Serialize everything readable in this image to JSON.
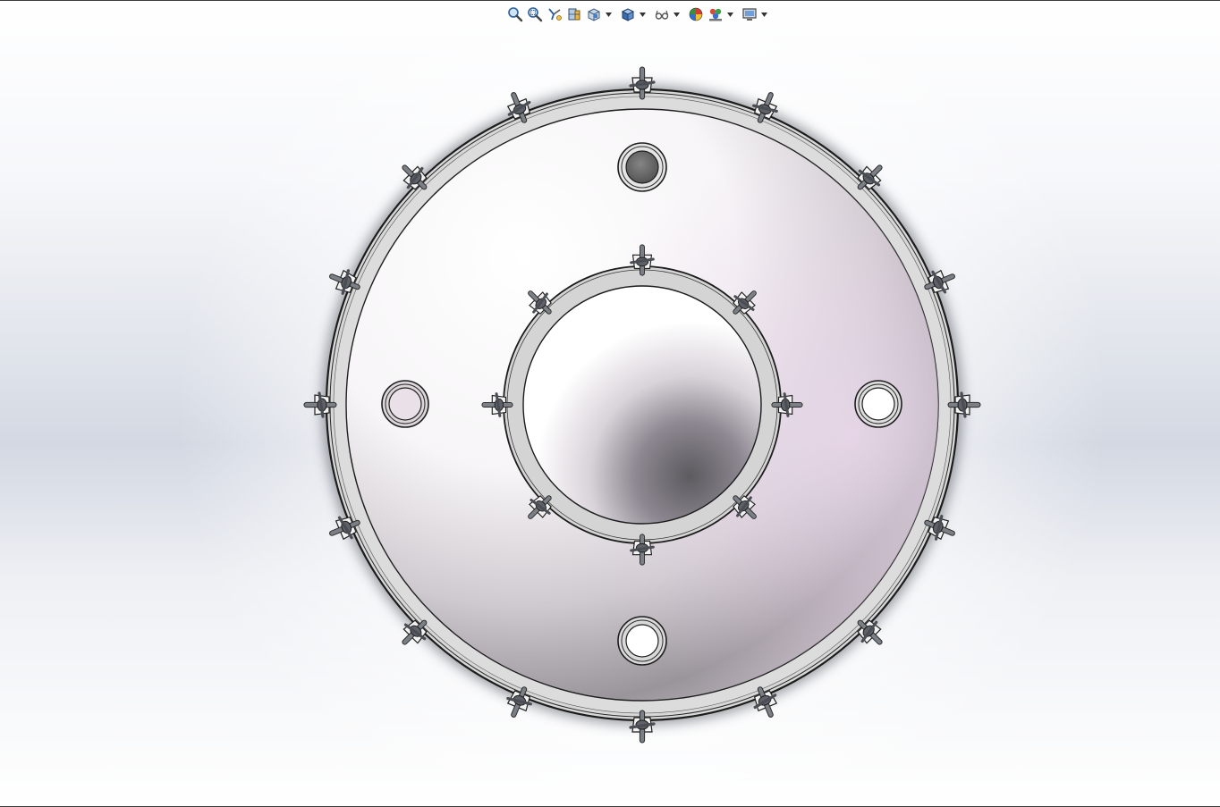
{
  "app": {
    "view": "graphics-area",
    "background": [
      "#ffffff",
      "#d3d8e2"
    ]
  },
  "toolbar": {
    "items": [
      {
        "id": "zoom-to-fit",
        "icon": "magnifier-icon",
        "dropdown": false
      },
      {
        "id": "zoom-to-area",
        "icon": "zoom-area-icon",
        "dropdown": false
      },
      {
        "id": "previous-view",
        "icon": "previous-view-icon",
        "dropdown": false
      },
      {
        "id": "section-view",
        "icon": "section-view-icon",
        "dropdown": false
      },
      {
        "id": "view-orientation",
        "icon": "view-orientation-icon",
        "dropdown": true
      },
      {
        "id": "display-style",
        "icon": "cube-icon",
        "dropdown": true
      },
      {
        "id": "hide-show-items",
        "icon": "eye-glasses-icon",
        "dropdown": true
      },
      {
        "id": "edit-appearance",
        "icon": "color-ball-icon",
        "dropdown": false
      },
      {
        "id": "apply-scene",
        "icon": "scene-icon",
        "dropdown": true
      },
      {
        "id": "view-settings",
        "icon": "monitor-icon",
        "dropdown": true
      }
    ]
  },
  "model": {
    "outer_clamp_count": 16,
    "inner_clamp_count": 8,
    "ports": [
      {
        "id": "top",
        "fill": "#6c6c6c"
      },
      {
        "id": "left",
        "fill": "#e8e0e6"
      },
      {
        "id": "right",
        "fill": "#ffffff"
      },
      {
        "id": "bottom",
        "fill": "#ffffff"
      }
    ],
    "colors": {
      "rim": "#d9d9d9",
      "edge": "#1e1e1e",
      "clamp": "#7b7f86"
    }
  }
}
